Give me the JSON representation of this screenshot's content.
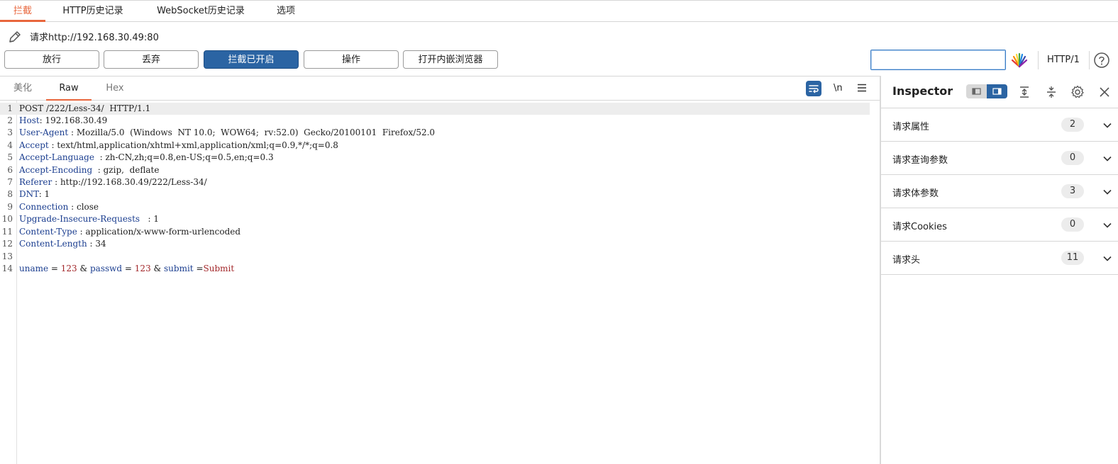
{
  "top_tabs": [
    {
      "label": "拦截"
    },
    {
      "label": "HTTP历史记录"
    },
    {
      "label": "WebSocket历史记录"
    },
    {
      "label": "选项"
    }
  ],
  "request": {
    "title": "请求http://192.168.30.49:80"
  },
  "toolbar": {
    "forward_label": "放行",
    "drop_label": "丢弃",
    "intercept_label": "拦截已开启",
    "action_label": "操作",
    "browser_label": "打开内嵌浏览器",
    "search_value": "",
    "http_version": "HTTP/1"
  },
  "editor": {
    "tabs": [
      {
        "label": "美化"
      },
      {
        "label": "Raw"
      },
      {
        "label": "Hex"
      }
    ],
    "newline_toggle": "\\n",
    "lines": [
      {
        "n": "1",
        "key": "",
        "value": "POST /222/Less-34/  HTTP/1.1"
      },
      {
        "n": "2",
        "key": "Host",
        "value": ": 192.168.30.49"
      },
      {
        "n": "3",
        "key": "User-Agent",
        "value": " : Mozilla/5.0  (Windows  NT 10.0;  WOW64;  rv:52.0)  Gecko/20100101  Firefox/52.0"
      },
      {
        "n": "4",
        "key": "Accept",
        "value": " : text/html,application/xhtml+xml,application/xml;q=0.9,*/*;q=0.8"
      },
      {
        "n": "5",
        "key": "Accept-Language",
        "value": "  : zh-CN,zh;q=0.8,en-US;q=0.5,en;q=0.3"
      },
      {
        "n": "6",
        "key": "Accept-Encoding",
        "value": "  : gzip,  deflate"
      },
      {
        "n": "7",
        "key": "Referer",
        "value": " : http://192.168.30.49/222/Less-34/"
      },
      {
        "n": "8",
        "key": "DNT",
        "value": ": 1"
      },
      {
        "n": "9",
        "key": "Connection",
        "value": " : close"
      },
      {
        "n": "10",
        "key": "Upgrade-Insecure-Requests",
        "value": "   : 1"
      },
      {
        "n": "11",
        "key": "Content-Type",
        "value": " : application/x-www-form-urlencoded"
      },
      {
        "n": "12",
        "key": "Content-Length",
        "value": " : 34"
      },
      {
        "n": "13",
        "key": "",
        "value": ""
      }
    ],
    "body_line": {
      "n": "14",
      "k1": "uname",
      "eq1": " = ",
      "v1": "123",
      "amp1": " & ",
      "k2": "passwd",
      "eq2": " = ",
      "v2": "123",
      "amp2": " & ",
      "k3": "submit",
      "eq3": " =",
      "v3": "Submit"
    }
  },
  "inspector": {
    "title": "Inspector",
    "sections": [
      {
        "label": "请求属性",
        "count": "2"
      },
      {
        "label": "请求查询参数",
        "count": "0"
      },
      {
        "label": "请求体参数",
        "count": "3"
      },
      {
        "label": "请求Cookies",
        "count": "0"
      },
      {
        "label": "请求头",
        "count": "11"
      }
    ]
  },
  "colors": {
    "accent": "#e8663c",
    "primary": "#2b64a3",
    "header_key": "#1a3d8f",
    "param_value": "#a3282b"
  }
}
